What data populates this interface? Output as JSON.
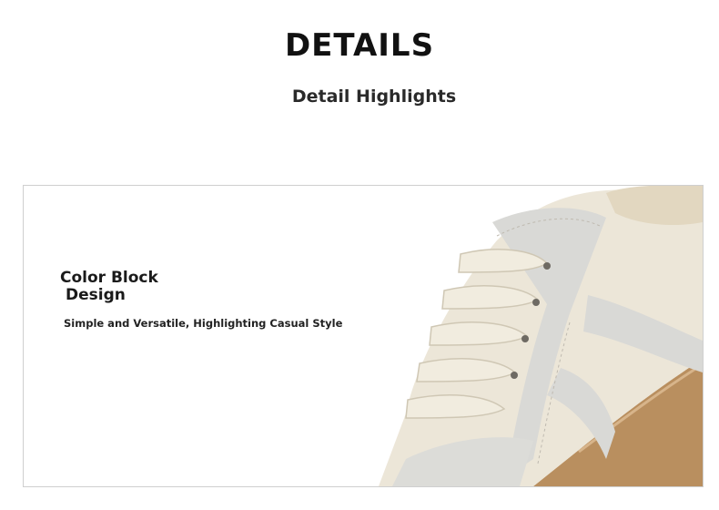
{
  "header": {
    "title": "DETAILS",
    "subtitle": "Detail Highlights"
  },
  "feature": {
    "title_line1": "Color Block",
    "title_line2": "Design",
    "description": "Simple and Versatile, Highlighting Casual Style"
  },
  "image": {
    "subject": "shoe-closeup",
    "colors": {
      "leather": "#ece6d8",
      "suede": "#d9d9d6",
      "laces": "#f1ecdf",
      "sole": "#b98f5f",
      "border": "#cfcfcf"
    }
  }
}
